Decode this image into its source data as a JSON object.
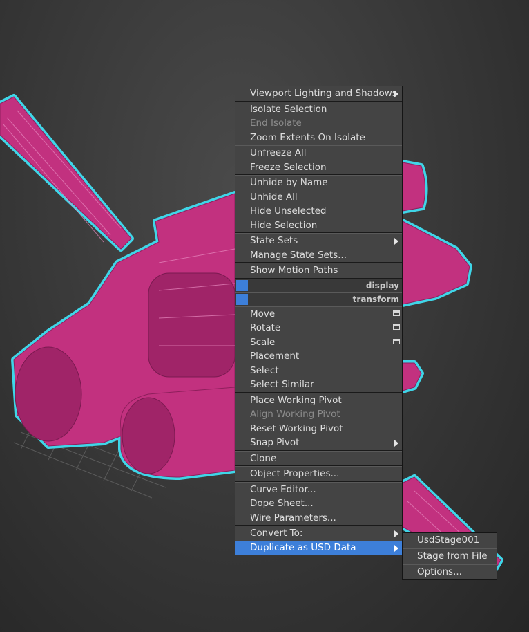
{
  "quad_menu": {
    "lighting_group": {
      "viewport_lighting": "Viewport Lighting and Shadows"
    },
    "isolate_group": {
      "isolate_selection": "Isolate Selection",
      "end_isolate": "End Isolate",
      "zoom_extents_on_isolate": "Zoom Extents On Isolate"
    },
    "freeze_group": {
      "unfreeze_all": "Unfreeze All",
      "freeze_selection": "Freeze Selection"
    },
    "hide_group": {
      "unhide_by_name": "Unhide by Name",
      "unhide_all": "Unhide All",
      "hide_unselected": "Hide Unselected",
      "hide_selection": "Hide Selection"
    },
    "state_group": {
      "state_sets": "State Sets",
      "manage_state_sets": "Manage State Sets..."
    },
    "motion_group": {
      "show_motion_paths": "Show Motion Paths"
    },
    "display_header": "display",
    "transform_header": "transform",
    "transform_group": {
      "move": "Move",
      "rotate": "Rotate",
      "scale": "Scale",
      "placement": "Placement",
      "select": "Select",
      "select_similar": "Select Similar"
    },
    "pivot_group": {
      "place_working_pivot": "Place Working Pivot",
      "align_working_pivot": "Align Working Pivot",
      "reset_working_pivot": "Reset Working Pivot",
      "snap_pivot": "Snap Pivot"
    },
    "clone_group": {
      "clone": "Clone"
    },
    "properties_group": {
      "object_properties": "Object Properties..."
    },
    "editor_group": {
      "curve_editor": "Curve Editor...",
      "dope_sheet": "Dope Sheet...",
      "wire_parameters": "Wire Parameters..."
    },
    "convert_group": {
      "convert_to": "Convert To:",
      "duplicate_as_usd": "Duplicate as USD Data"
    }
  },
  "usd_submenu": {
    "usd_stage": "UsdStage001",
    "stage_from_file": "Stage from File",
    "options": "Options..."
  },
  "colors": {
    "highlight": "#3d7fd9",
    "menu_bg": "#444444",
    "model_fill": "#c2317f",
    "selection_outline": "#3fd6e8"
  }
}
